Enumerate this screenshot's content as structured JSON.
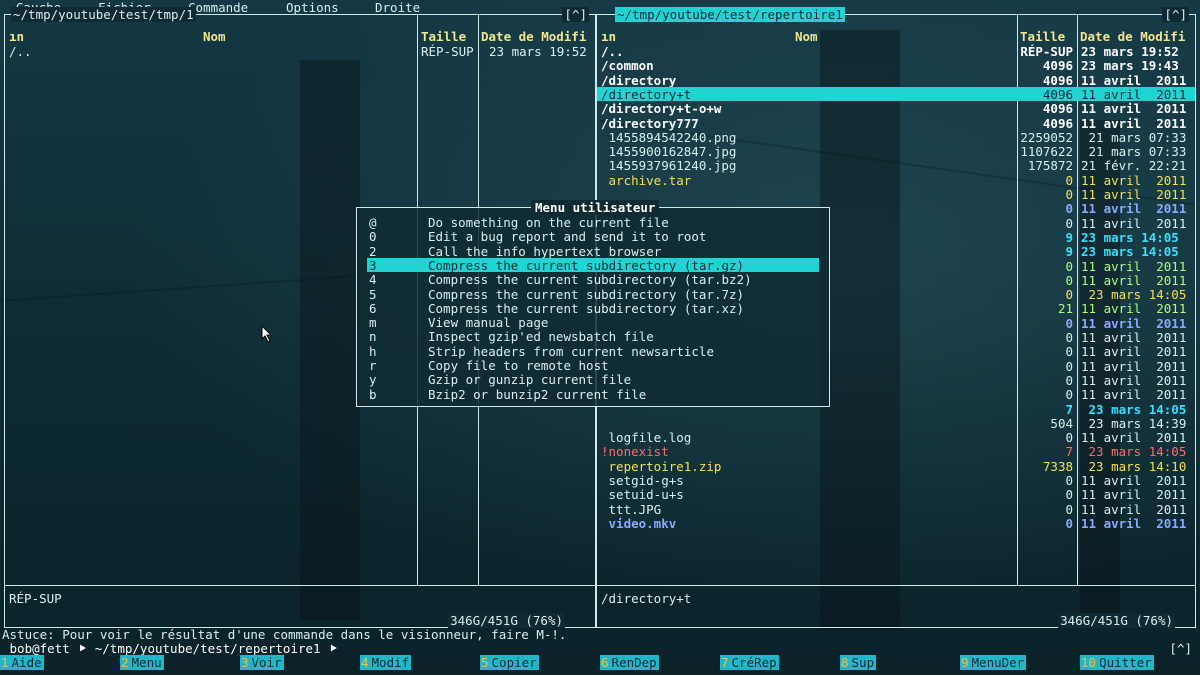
{
  "menubar": {
    "items": [
      "Gauche",
      "Fichier",
      "Commande",
      "Options",
      "Droite"
    ]
  },
  "left_panel": {
    "path": "~/tmp/youtube/test/tmp/1",
    "corner": "[^]",
    "headers": {
      "sort": "ın",
      "name": "Nom",
      "size": "Taille",
      "date": "Date de Modifi"
    },
    "rows": [
      {
        "name": "/..",
        "size": "RÉP-SUP",
        "date": "23 mars 19:52"
      }
    ],
    "footer_selected": "RÉP-SUP",
    "footer_disk": "346G/451G (76%)"
  },
  "right_panel": {
    "path": "~/tmp/youtube/test/repertoire1",
    "corner": "[^]",
    "headers": {
      "sort": "ın",
      "name": "Nom",
      "size": "Taille",
      "date": "Date de Modifi"
    },
    "rows": [
      {
        "name": "/..",
        "size": "RÉP-SUP",
        "date": "23 mars 19:52",
        "style": "dir"
      },
      {
        "name": "/common",
        "size": "4096",
        "date": "23 mars 19:43",
        "style": "dir"
      },
      {
        "name": "/directory",
        "size": "4096",
        "date": "11 avril  2011",
        "style": "dir"
      },
      {
        "name": "/directory+t",
        "size": "4096",
        "date": "11 avril  2011",
        "style": "sel"
      },
      {
        "name": "/directory+t-o+w",
        "size": "4096",
        "date": "11 avril  2011",
        "style": "dir"
      },
      {
        "name": "/directory777",
        "size": "4096",
        "date": "11 avril  2011",
        "style": "dir"
      },
      {
        "name": " 1455894542240.png",
        "size": "2259052",
        "date": " 21 mars 07:33",
        "style": "file"
      },
      {
        "name": " 1455900162847.jpg",
        "size": "1107622",
        "date": " 21 mars 07:33",
        "style": "file"
      },
      {
        "name": " 1455937961240.jpg",
        "size": "175872",
        "date": "21 févr. 22:21",
        "style": "file"
      },
      {
        "name": " archive.tar",
        "size": "0",
        "date": "11 avril  2011",
        "style": "yellow"
      },
      {
        "name": "",
        "size": "0",
        "date": "11 avril  2011",
        "style": "yellow"
      },
      {
        "name": "",
        "size": "0",
        "date": "11 avril  2011",
        "style": "blue"
      },
      {
        "name": "",
        "size": "0",
        "date": "11 avril  2011",
        "style": "file"
      },
      {
        "name": "",
        "size": "9",
        "date": "23 mars 14:05",
        "style": "cyan"
      },
      {
        "name": "",
        "size": "9",
        "date": "23 mars 14:05",
        "style": "cyan"
      },
      {
        "name": "",
        "size": "0",
        "date": "11 avril  2011",
        "style": "green"
      },
      {
        "name": "",
        "size": "0",
        "date": "11 avril  2011",
        "style": "green"
      },
      {
        "name": "",
        "size": "0",
        "date": " 23 mars 14:05",
        "style": "yellow"
      },
      {
        "name": "",
        "size": "21",
        "date": "11 avril  2011",
        "style": "green"
      },
      {
        "name": "",
        "size": "0",
        "date": "11 avril  2011",
        "style": "blue"
      },
      {
        "name": "",
        "size": "0",
        "date": "11 avril  2011",
        "style": "file"
      },
      {
        "name": "",
        "size": "0",
        "date": "11 avril  2011",
        "style": "file"
      },
      {
        "name": "",
        "size": "0",
        "date": "11 avril  2011",
        "style": "file"
      },
      {
        "name": "",
        "size": "0",
        "date": "11 avril  2011",
        "style": "file"
      },
      {
        "name": "",
        "size": "0",
        "date": "11 avril  2011",
        "style": "file"
      },
      {
        "name": "",
        "size": "7",
        "date": " 23 mars 14:05",
        "style": "cyan"
      },
      {
        "name": "",
        "size": "504",
        "date": " 23 mars 14:39",
        "style": "file"
      },
      {
        "name": " logfile.log",
        "size": "0",
        "date": "11 avril  2011",
        "style": "file"
      },
      {
        "name": "!nonexist",
        "size": "7",
        "date": " 23 mars 14:05",
        "style": "red"
      },
      {
        "name": " repertoire1.zip",
        "size": "7338",
        "date": " 23 mars 14:10",
        "style": "yellow"
      },
      {
        "name": " setgid-g+s",
        "size": "0",
        "date": "11 avril  2011",
        "style": "file"
      },
      {
        "name": " setuid-u+s",
        "size": "0",
        "date": "11 avril  2011",
        "style": "file"
      },
      {
        "name": " ttt.JPG",
        "size": "0",
        "date": "11 avril  2011",
        "style": "file"
      },
      {
        "name": " video.mkv",
        "size": "0",
        "date": "11 avril  2011",
        "style": "blue"
      }
    ],
    "footer_selected": "/directory+t",
    "footer_disk": "346G/451G (76%)"
  },
  "user_menu": {
    "title": "Menu utilisateur",
    "items": [
      {
        "key": "@",
        "label": "Do something on the current file"
      },
      {
        "key": "0",
        "label": "Edit a bug report and send it to root"
      },
      {
        "key": "2",
        "label": "Call the info hypertext browser"
      },
      {
        "key": "3",
        "label": "Compress the current subdirectory (tar.gz)",
        "selected": true
      },
      {
        "key": "4",
        "label": "Compress the current subdirectory (tar.bz2)"
      },
      {
        "key": "5",
        "label": "Compress the current subdirectory (tar.7z)"
      },
      {
        "key": "6",
        "label": "Compress the current subdirectory (tar.xz)"
      },
      {
        "key": "m",
        "label": "View manual page"
      },
      {
        "key": "n",
        "label": "Inspect gzip'ed newsbatch file"
      },
      {
        "key": "h",
        "label": "Strip headers from current newsarticle"
      },
      {
        "key": "r",
        "label": "Copy file to remote host"
      },
      {
        "key": "y",
        "label": "Gzip or gunzip current file"
      },
      {
        "key": "b",
        "label": "Bzip2 or bunzip2 current file"
      }
    ]
  },
  "hint": "Astuce: Pour voir le résultat d'une commande dans le visionneur, faire M-!.",
  "prompt": {
    "text": " bob@fett ⯈ ~/tmp/youtube/test/repertoire1 ⯈",
    "corner": "[^]"
  },
  "fkeys": [
    {
      "num": "1",
      "label": "Aide"
    },
    {
      "num": "2",
      "label": "Menu"
    },
    {
      "num": "3",
      "label": "Voir"
    },
    {
      "num": "4",
      "label": "Modif"
    },
    {
      "num": "5",
      "label": "Copier"
    },
    {
      "num": "6",
      "label": "RenDep"
    },
    {
      "num": "7",
      "label": "CréRep"
    },
    {
      "num": "8",
      "label": "Sup"
    },
    {
      "num": "9",
      "label": "MenuDer"
    },
    {
      "num": "10",
      "label": "Quitter"
    }
  ]
}
